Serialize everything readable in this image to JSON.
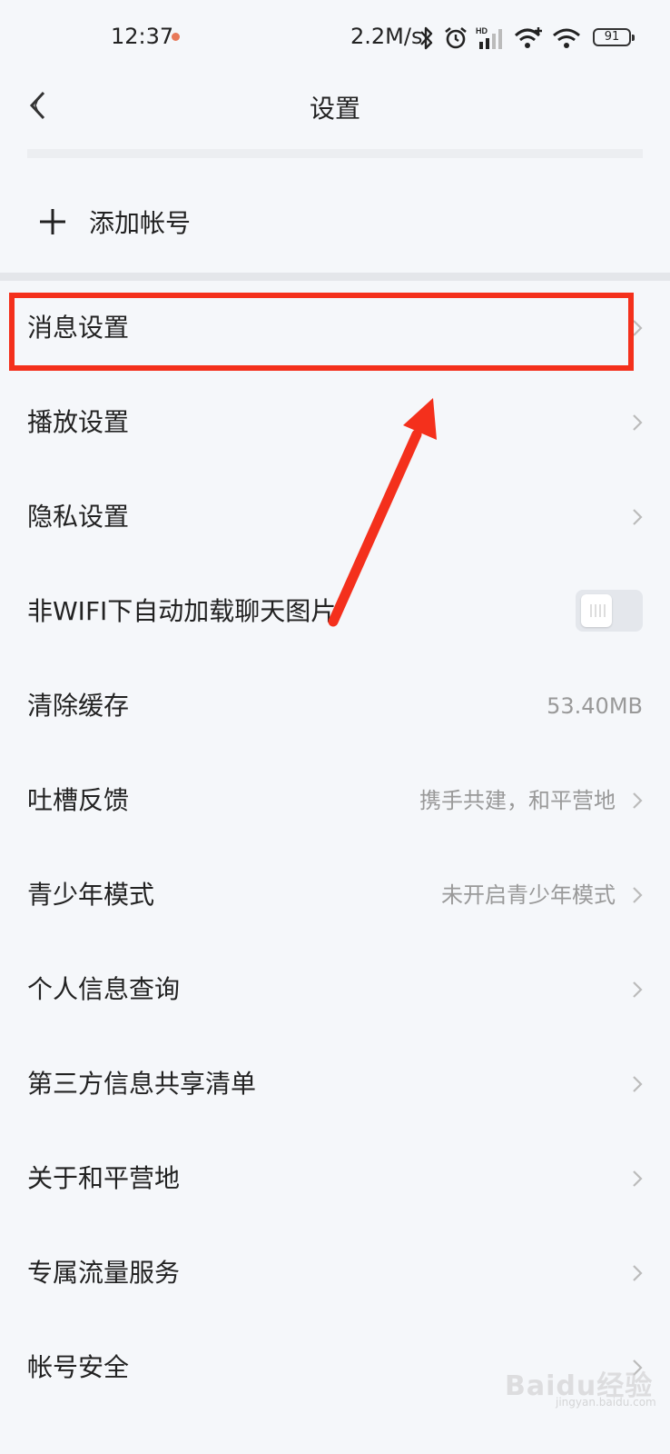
{
  "status_bar": {
    "time": "12:37",
    "network_speed": "2.2M/s",
    "battery": "91",
    "icons": [
      "bluetooth-icon",
      "alarm-icon",
      "hd-signal-icon",
      "wifi-plus-icon",
      "wifi-icon",
      "battery-icon"
    ]
  },
  "header": {
    "title": "设置"
  },
  "add_account": {
    "label": "添加帐号"
  },
  "settings": {
    "items": [
      {
        "label": "消息设置"
      },
      {
        "label": "播放设置"
      },
      {
        "label": "隐私设置"
      },
      {
        "label": "非WIFI下自动加载聊天图片"
      },
      {
        "label": "清除缓存",
        "value": "53.40MB"
      },
      {
        "label": "吐槽反馈",
        "value": "携手共建，和平营地"
      },
      {
        "label": "青少年模式",
        "value": "未开启青少年模式"
      },
      {
        "label": "个人信息查询"
      },
      {
        "label": "第三方信息共享清单"
      },
      {
        "label": "关于和平营地"
      },
      {
        "label": "专属流量服务"
      },
      {
        "label": "帐号安全"
      }
    ],
    "auto_load_images_enabled": false
  },
  "annotation": {
    "highlight_color": "#f4301c"
  },
  "watermark": {
    "text": "Baidu经验",
    "sub": "jingyan.baidu.com"
  }
}
